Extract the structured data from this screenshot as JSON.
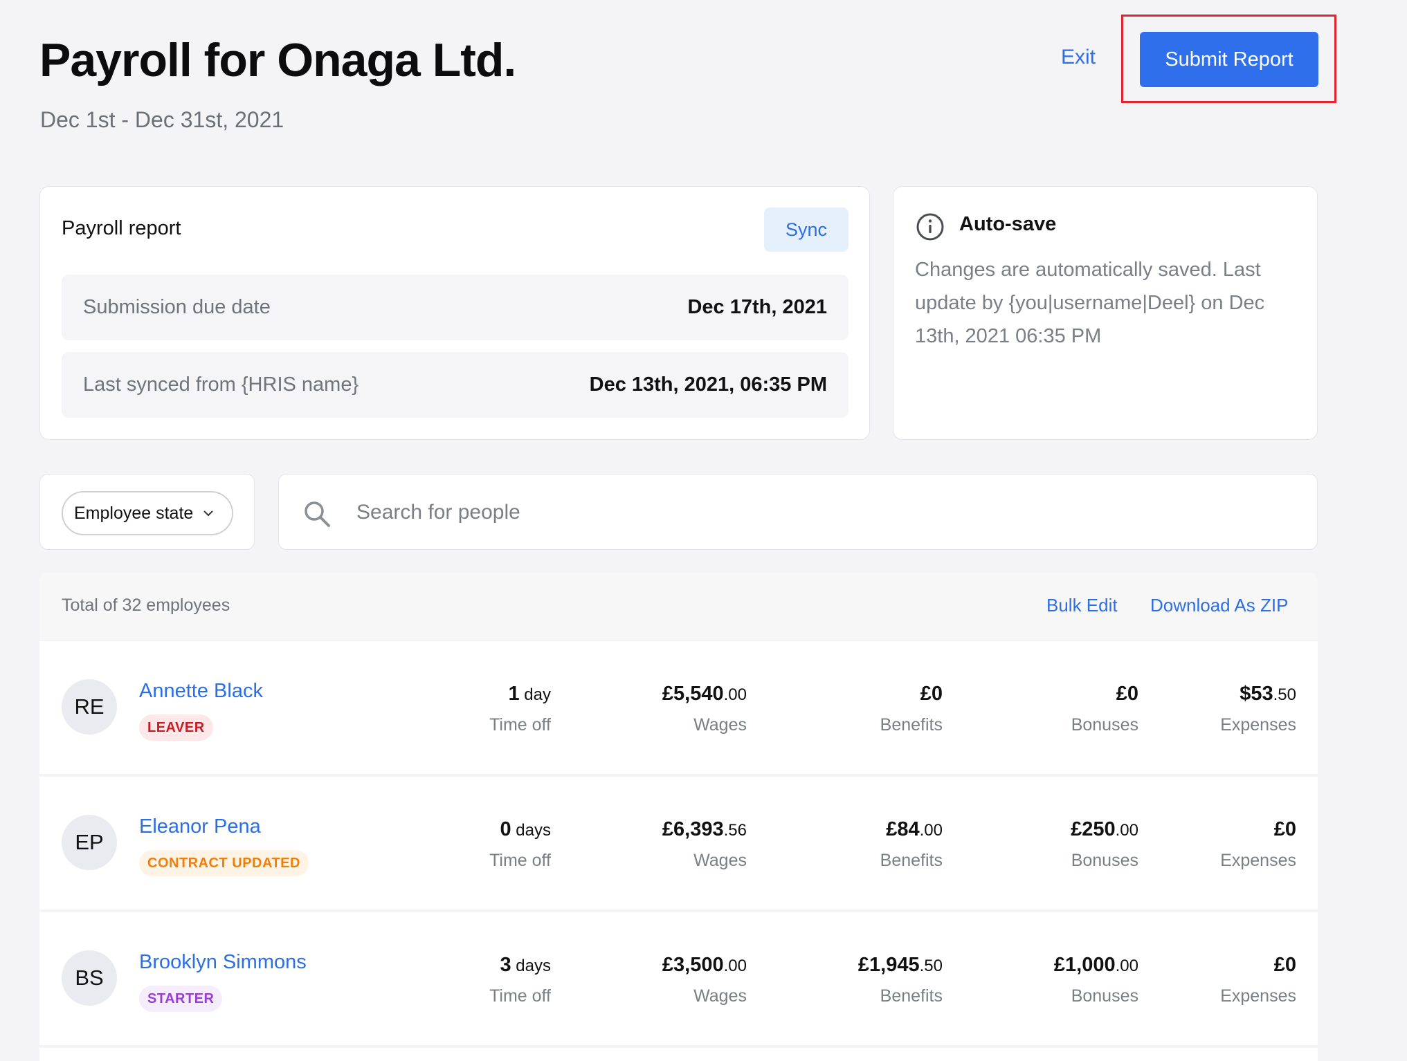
{
  "header": {
    "title": "Payroll for Onaga Ltd.",
    "subtitle": "Dec 1st - Dec 31st, 2021",
    "exit_label": "Exit",
    "submit_label": "Submit Report",
    "highlight_color": "#e52330",
    "accent_color": "#2f6feb"
  },
  "report": {
    "title": "Payroll report",
    "sync_label": "Sync",
    "rows": [
      {
        "label": "Submission due date",
        "value": "Dec 17th, 2021"
      },
      {
        "label": "Last synced from {HRIS name}",
        "value": "Dec 13th, 2021, 06:35 PM"
      }
    ]
  },
  "autosave": {
    "icon": "info-icon",
    "title": "Auto-save",
    "text": "Changes are automatically saved. Last update by {you|username|Deel} on Dec 13th, 2021 06:35 PM"
  },
  "filters": {
    "employee_state_label": "Employee state",
    "search_placeholder": "Search for people",
    "search_value": ""
  },
  "list": {
    "total_text": "Total of 32 employees",
    "bulk_edit_label": "Bulk Edit",
    "download_label": "Download As ZIP",
    "labels": {
      "time_off": "Time off",
      "wages": "Wages",
      "benefits": "Benefits",
      "bonuses": "Bonuses",
      "expenses": "Expenses"
    },
    "employees": [
      {
        "initials": "RE",
        "name": "Annette Black",
        "status": "LEAVER",
        "time_off": {
          "num": "1",
          "unit": " day"
        },
        "wages": {
          "main": "£5,540",
          "cents": ".00"
        },
        "benefits": {
          "main": "£0",
          "cents": ""
        },
        "bonuses": {
          "main": "£0",
          "cents": ""
        },
        "expenses": {
          "main": "$53",
          "cents": ".50"
        }
      },
      {
        "initials": "EP",
        "name": "Eleanor Pena",
        "status": "CONTRACT UPDATED",
        "time_off": {
          "num": "0",
          "unit": " days"
        },
        "wages": {
          "main": "£6,393",
          "cents": ".56"
        },
        "benefits": {
          "main": "£84",
          "cents": ".00"
        },
        "bonuses": {
          "main": "£250",
          "cents": ".00"
        },
        "expenses": {
          "main": "£0",
          "cents": ""
        }
      },
      {
        "initials": "BS",
        "name": "Brooklyn Simmons",
        "status": "STARTER",
        "time_off": {
          "num": "3",
          "unit": " days"
        },
        "wages": {
          "main": "£3,500",
          "cents": ".00"
        },
        "benefits": {
          "main": "£1,945",
          "cents": ".50"
        },
        "bonuses": {
          "main": "£1,000",
          "cents": ".00"
        },
        "expenses": {
          "main": "£0",
          "cents": ""
        }
      }
    ]
  }
}
